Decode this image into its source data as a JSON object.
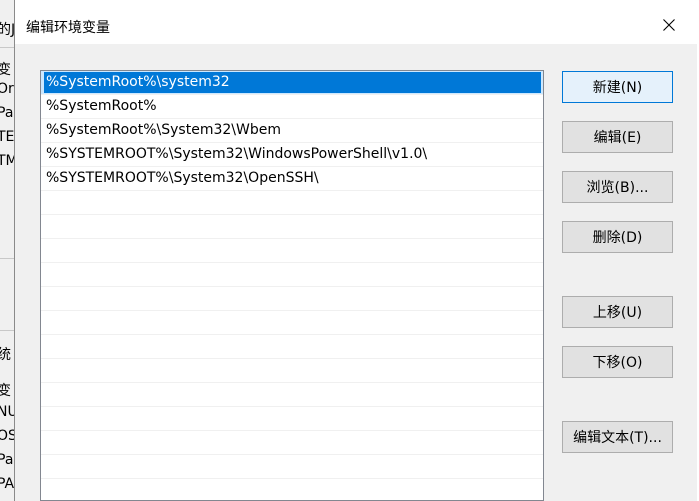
{
  "background_window": {
    "fragments": [
      "的J",
      "变",
      "Or",
      "Pa",
      "TE",
      "TM",
      "统",
      "变",
      "NU",
      "OS",
      "Pa",
      "PA"
    ]
  },
  "dialog": {
    "title": "编辑环境变量",
    "close_label": "✕"
  },
  "list": {
    "items": [
      "%SystemRoot%\\system32",
      "%SystemRoot%",
      "%SystemRoot%\\System32\\Wbem",
      "%SYSTEMROOT%\\System32\\WindowsPowerShell\\v1.0\\",
      "%SYSTEMROOT%\\System32\\OpenSSH\\"
    ],
    "selected_index": 0
  },
  "buttons": {
    "new": "新建(N)",
    "edit": "编辑(E)",
    "browse": "浏览(B)...",
    "delete": "删除(D)",
    "move_up": "上移(U)",
    "move_down": "下移(O)",
    "edit_text": "编辑文本(T)..."
  },
  "colors": {
    "selection": "#0078d7",
    "default_button_border": "#0078d7"
  }
}
